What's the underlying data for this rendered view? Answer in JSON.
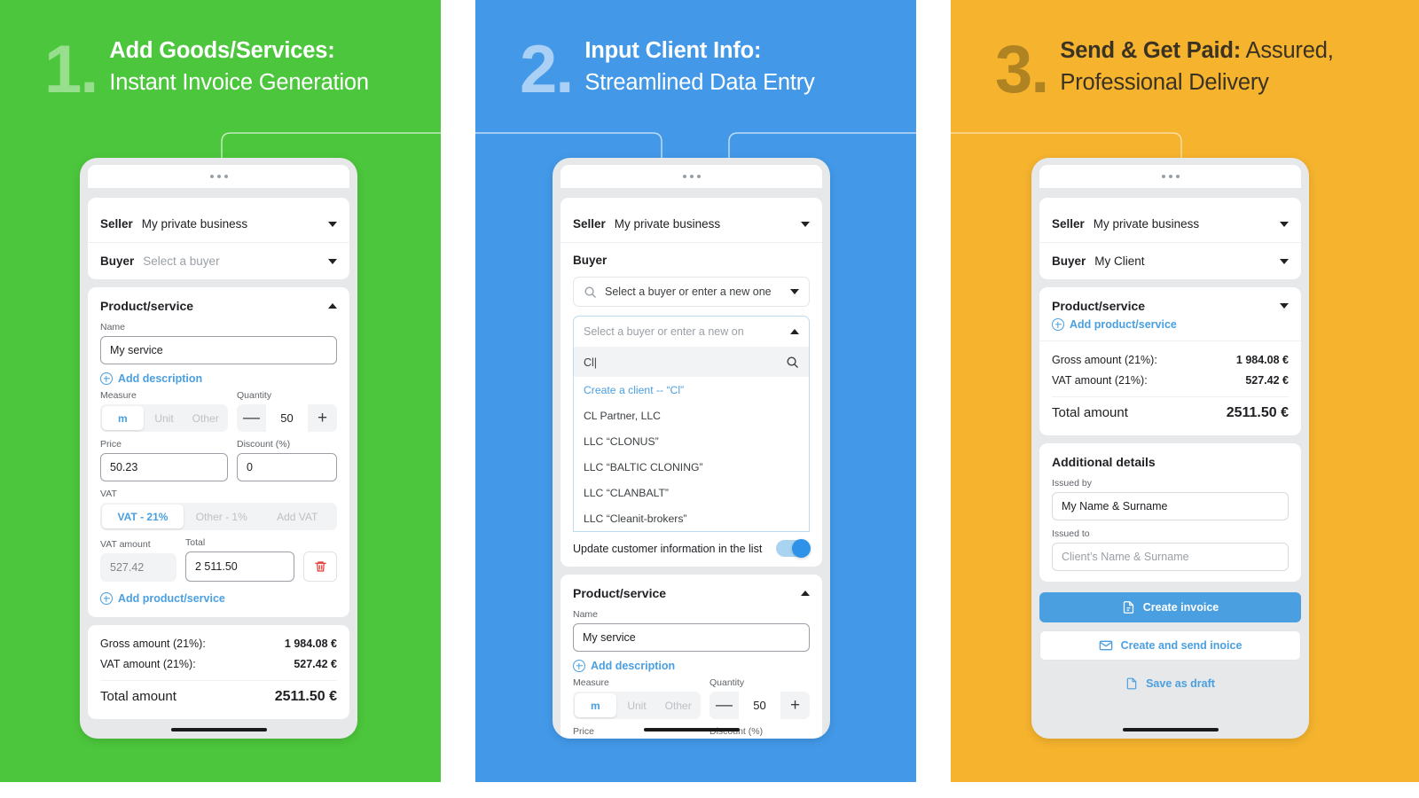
{
  "theme": {
    "green": "#4CC63C",
    "blue": "#4399E8",
    "yellow": "#F5B32E",
    "accent_blue": "#4A9FE0",
    "danger_red": "#E53935"
  },
  "steps": [
    {
      "number": "1.",
      "title_bold": "Add Goods/Services:",
      "title_rest": "Instant Invoice Generation"
    },
    {
      "number": "2.",
      "title_bold": "Input Client Info:",
      "title_rest": "Streamlined Data Entry"
    },
    {
      "number": "3.",
      "title_bold": "Send & Get Paid:",
      "title_rest": "Assured, Professional Delivery"
    }
  ],
  "screen1": {
    "seller_label": "Seller",
    "seller_value": "My private business",
    "buyer_label": "Buyer",
    "buyer_placeholder": "Select a buyer",
    "section_title": "Product/service",
    "name_label": "Name",
    "name_value": "My service",
    "add_description": "Add description",
    "measure_label": "Measure",
    "measure_options": [
      "m",
      "Unit",
      "Other"
    ],
    "measure_selected": "m",
    "quantity_label": "Quantity",
    "quantity_value": "50",
    "minus": "—",
    "plus": "+",
    "price_label": "Price",
    "price_value": "50.23",
    "discount_label": "Discount (%)",
    "discount_value": "0",
    "vat_label": "VAT",
    "vat_options": [
      "VAT - 21%",
      "Other - 1%",
      "Add VAT"
    ],
    "vat_selected": "VAT - 21%",
    "vat_amount_label": "VAT amount",
    "vat_amount_value": "527.42",
    "total_label": "Total",
    "total_value": "2 511.50",
    "add_product": "Add product/service",
    "gross_label": "Gross amount (21%):",
    "gross_value": "1 984.08 €",
    "vat_sum_label": "VAT amount (21%):",
    "vat_sum_value": "527.42 €",
    "total_amount_label": "Total amount",
    "total_amount_value": "2511.50 €"
  },
  "screen2": {
    "seller_label": "Seller",
    "seller_value": "My private business",
    "buyer_label": "Buyer",
    "combo_placeholder": "Select a buyer or enter a new one",
    "dropdown_header": "Select a buyer or enter a new on",
    "search_query": "Cl|",
    "create_option": "Create a client -- “Cl”",
    "options": [
      "CL Partner, LLC",
      "LLC “CLONUS”",
      "LLC “BALTIC CLONING”",
      "LLC “CLANBALT”",
      "LLC “Cleanit-brokers”"
    ],
    "toggle_label": "Update customer information in the list",
    "toggle_on": true,
    "section_title": "Product/service",
    "name_label": "Name",
    "name_value": "My service",
    "add_description": "Add description",
    "measure_label": "Measure",
    "measure_options": [
      "m",
      "Unit",
      "Other"
    ],
    "measure_selected": "m",
    "quantity_label": "Quantity",
    "quantity_value": "50",
    "minus": "—",
    "plus": "+",
    "price_label": "Price",
    "discount_label": "Discount (%)"
  },
  "screen3": {
    "seller_label": "Seller",
    "seller_value": "My private business",
    "buyer_label": "Buyer",
    "buyer_value": "My Client",
    "section_title": "Product/service",
    "add_product": "Add product/service",
    "gross_label": "Gross amount (21%):",
    "gross_value": "1 984.08 €",
    "vat_sum_label": "VAT amount (21%):",
    "vat_sum_value": "527.42 €",
    "total_amount_label": "Total amount",
    "total_amount_value": "2511.50 €",
    "additional_title": "Additional details",
    "issued_by_label": "Issued by",
    "issued_by_value": "My Name & Surname",
    "issued_to_label": "Issued to",
    "issued_to_placeholder": "Client’s Name & Surname",
    "btn_create": "Create invoice",
    "btn_create_send": "Create and send inoice",
    "btn_save_draft": "Save as draft"
  }
}
